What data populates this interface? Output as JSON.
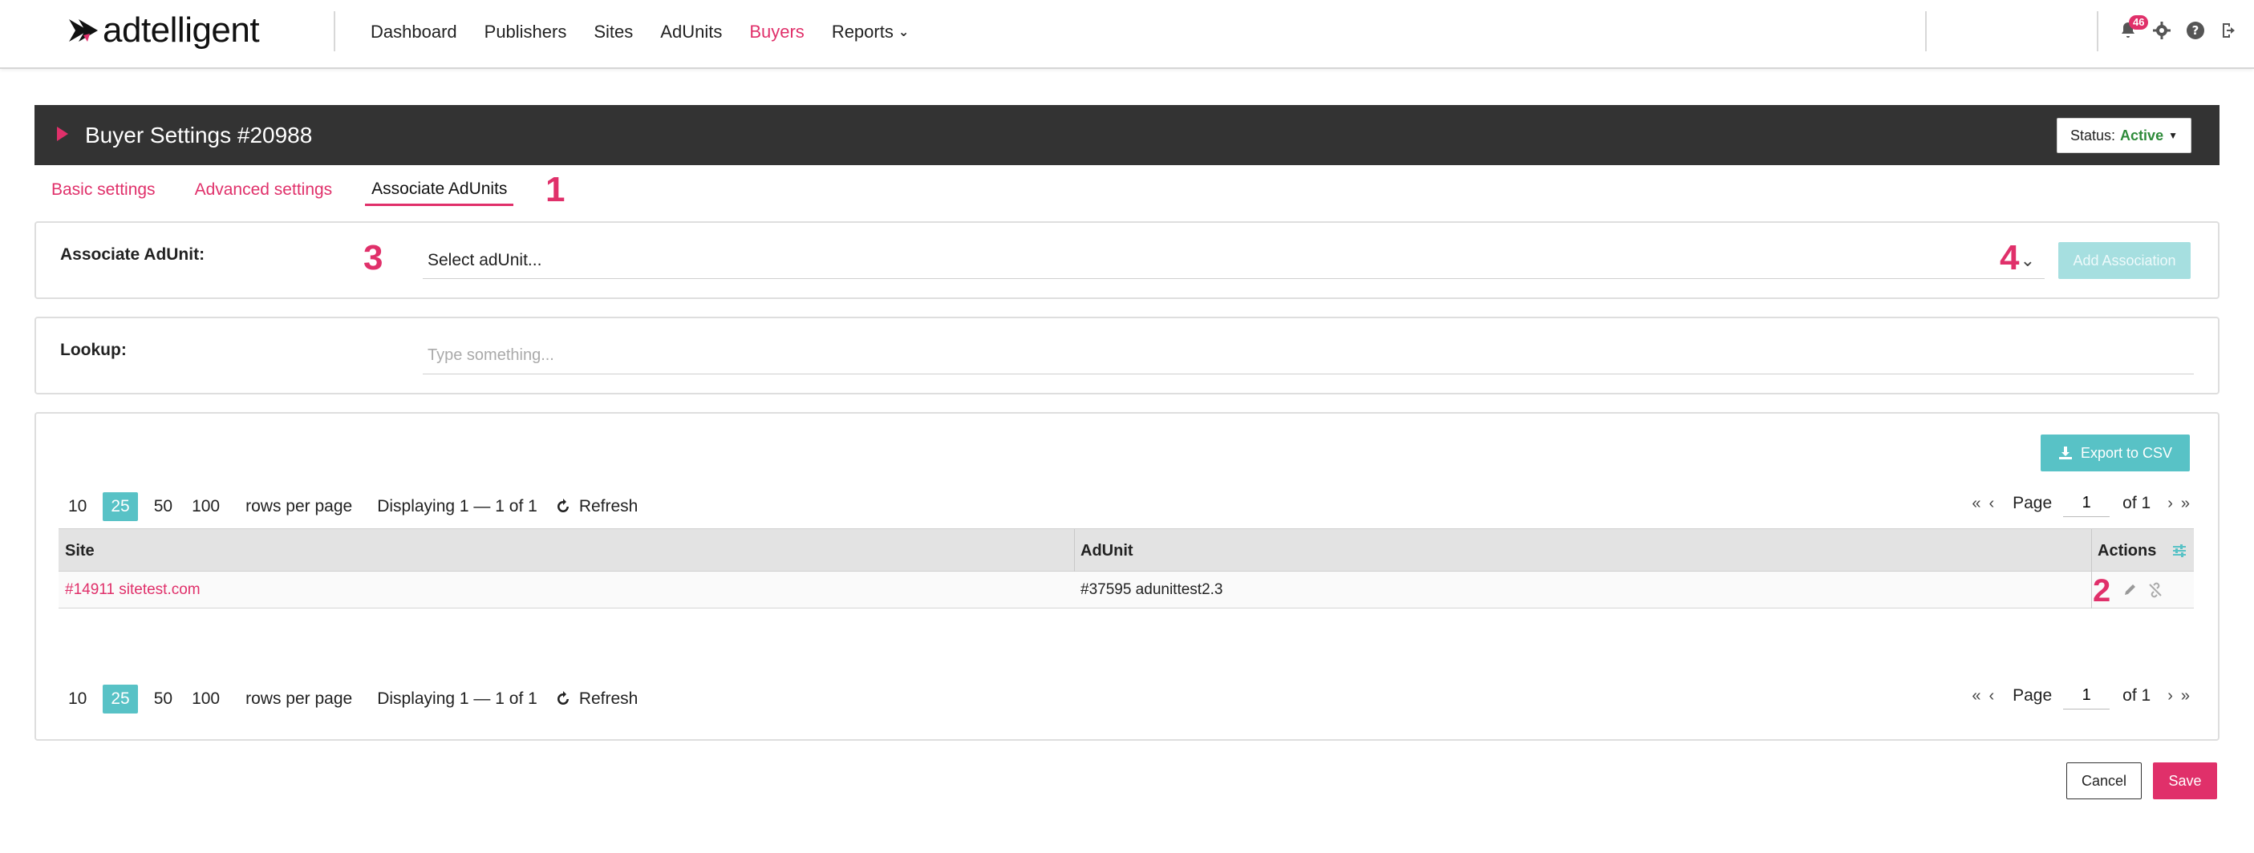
{
  "app": {
    "logo_text": "adtelligent"
  },
  "nav": {
    "items": [
      {
        "label": "Dashboard"
      },
      {
        "label": "Publishers"
      },
      {
        "label": "Sites"
      },
      {
        "label": "AdUnits"
      },
      {
        "label": "Buyers",
        "active": true
      },
      {
        "label": "Reports"
      }
    ],
    "notifications_count": "46",
    "icons": [
      "bell-icon",
      "gear-icon",
      "help-icon",
      "logout-icon"
    ]
  },
  "header": {
    "title": "Buyer Settings #20988",
    "status_label": "Status:",
    "status_value": "Active"
  },
  "tabs": [
    {
      "label": "Basic settings"
    },
    {
      "label": "Advanced settings"
    },
    {
      "label": "Associate AdUnits",
      "active": true
    }
  ],
  "annotations": {
    "a1": "1",
    "a2": "2",
    "a3": "3",
    "a4": "4"
  },
  "associate": {
    "label": "Associate AdUnit:",
    "select_value": "Select adUnit...",
    "add_button": "Add Association"
  },
  "lookup": {
    "label": "Lookup:",
    "placeholder": "Type something..."
  },
  "table_panel": {
    "export_button": "Export to CSV",
    "rows_per_page_options": [
      "10",
      "25",
      "50",
      "100"
    ],
    "rows_per_page_selected": "25",
    "rows_per_page_label": "rows per page",
    "displaying": "Displaying 1 — 1 of 1",
    "refresh": "Refresh",
    "page_label": "Page",
    "page_value": "1",
    "page_of": "of 1",
    "columns": [
      "Site",
      "AdUnit",
      "Actions"
    ],
    "rows": [
      {
        "site": "#14911 sitetest.com",
        "adunit": "#37595 adunittest2.3"
      }
    ]
  },
  "footer": {
    "cancel": "Cancel",
    "save": "Save"
  },
  "colors": {
    "accent": "#e0306a",
    "teal": "#58c2c6",
    "header_bg": "#333333",
    "status_active": "#2e8b3a"
  }
}
